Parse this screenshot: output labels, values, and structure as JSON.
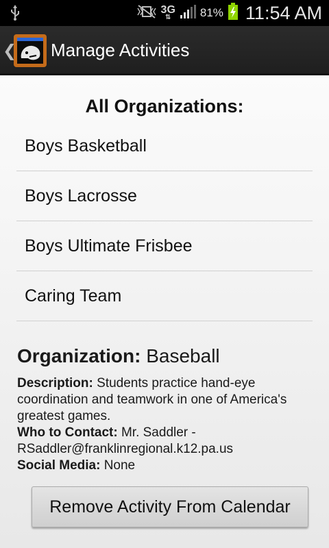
{
  "status_bar": {
    "battery_percent": "81%",
    "time": "11:54 AM",
    "network": "3G"
  },
  "action_bar": {
    "title": "Manage Activities"
  },
  "organizations": {
    "heading": "All Organizations:",
    "items": [
      {
        "label": "Boys Basketball"
      },
      {
        "label": "Boys Lacrosse"
      },
      {
        "label": "Boys Ultimate Frisbee"
      },
      {
        "label": "Caring Team"
      }
    ]
  },
  "details": {
    "org_label": "Organization:",
    "org_value": "Baseball",
    "description_label": "Description:",
    "description_value": "Students practice hand-eye coordination and teamwork in one of America's greatest games.",
    "contact_label": "Who to Contact:",
    "contact_value": "Mr. Saddler - RSaddler@franklinregional.k12.pa.us",
    "social_label": "Social Media:",
    "social_value": "None"
  },
  "actions": {
    "remove_label": "Remove Activity From Calendar"
  }
}
